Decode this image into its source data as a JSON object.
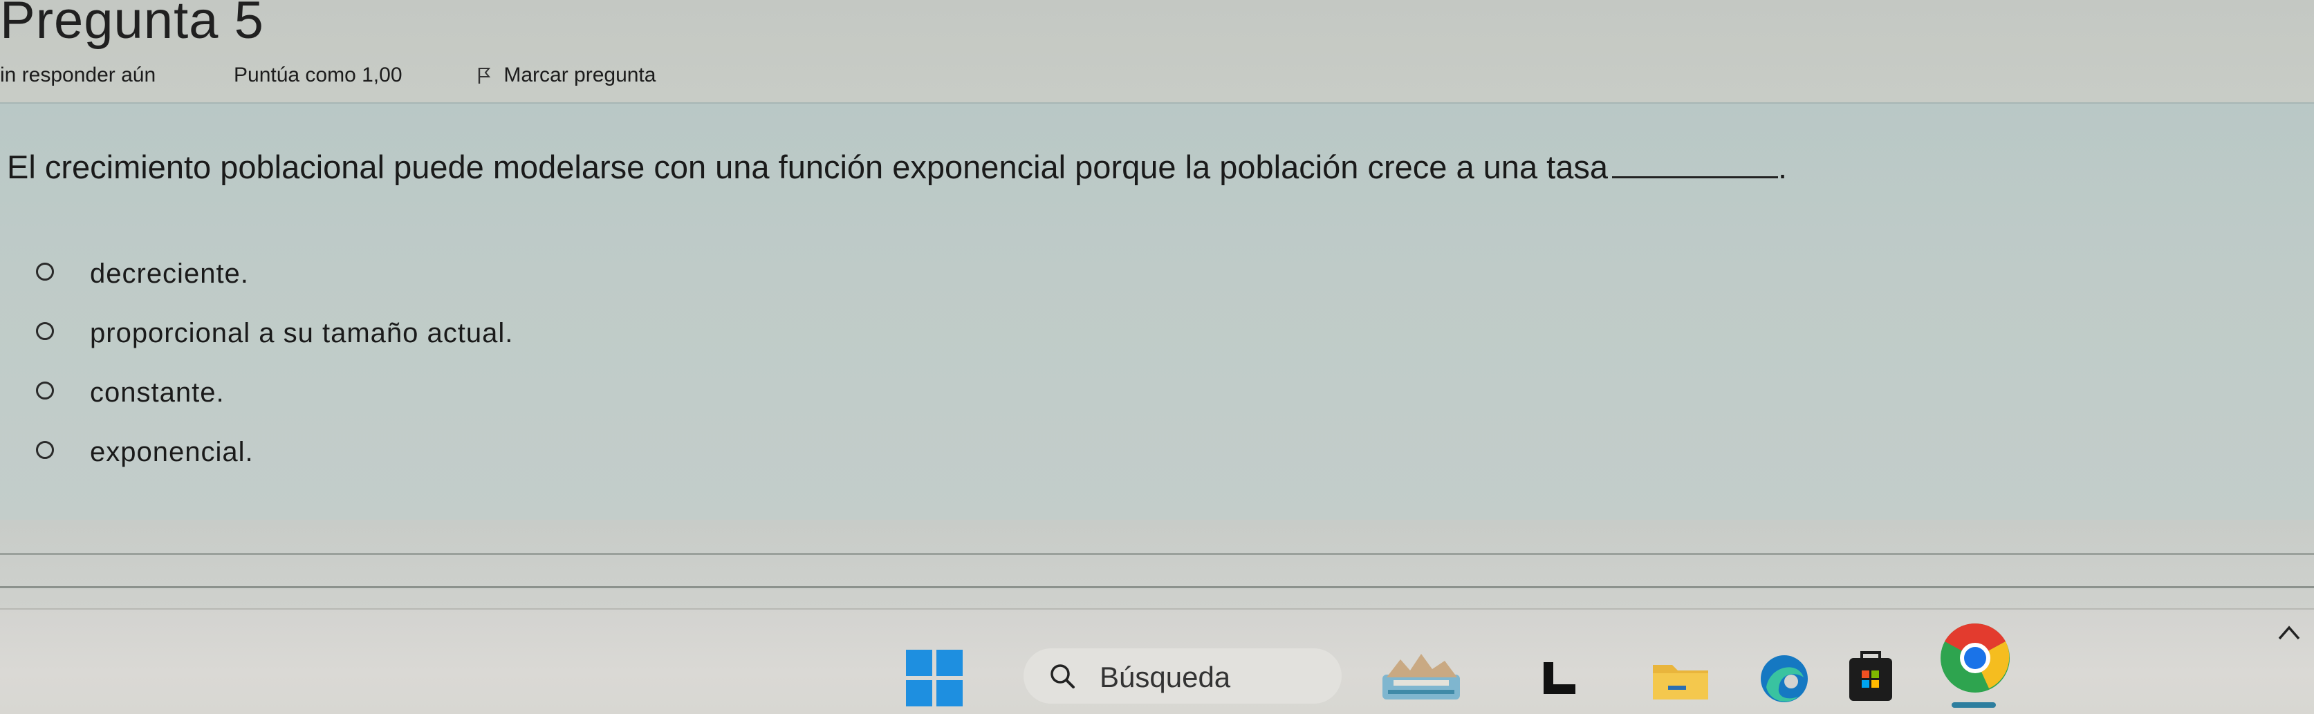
{
  "question": {
    "title": "Pregunta 5",
    "status": "in responder aún",
    "grade": "Puntúa como 1,00",
    "flag_label": "Marcar pregunta",
    "text": "El crecimiento poblacional puede modelarse con una función exponencial porque la población crece a una tasa",
    "text_end": ".",
    "options": [
      {
        "label": "decreciente.",
        "selected": false
      },
      {
        "label": "proporcional a su tamaño actual.",
        "selected": false
      },
      {
        "label": "constante.",
        "selected": false
      },
      {
        "label": "exponencial.",
        "selected": false
      }
    ]
  },
  "taskbar": {
    "search_label": "Búsqueda",
    "icons": [
      "start-icon",
      "search-icon",
      "widgets-icon",
      "task-view-icon",
      "file-explorer-icon",
      "edge-icon",
      "store-icon",
      "chrome-icon",
      "chevron-up-icon"
    ]
  },
  "colors": {
    "accent_blue": "#1e8fe0",
    "question_bg": "#bfcbc8",
    "text": "#1a1a1a"
  }
}
